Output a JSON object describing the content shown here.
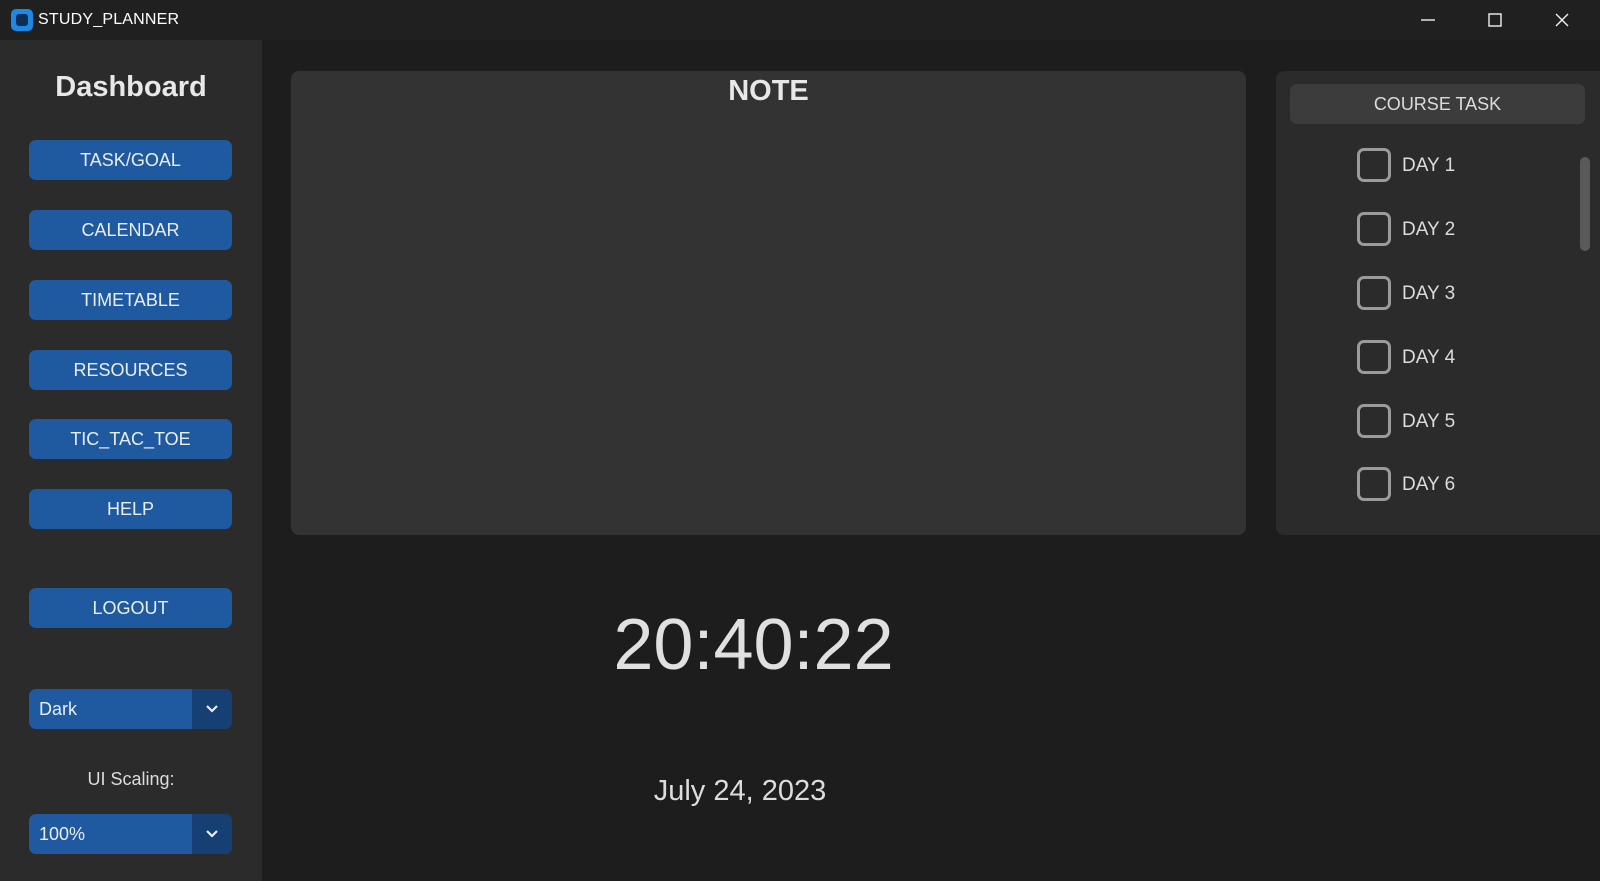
{
  "window": {
    "title": "STUDY_PLANNER"
  },
  "sidebar": {
    "title": "Dashboard",
    "nav": [
      {
        "label": "TASK/GOAL"
      },
      {
        "label": "CALENDAR"
      },
      {
        "label": "TIMETABLE"
      },
      {
        "label": "RESOURCES"
      },
      {
        "label": "TIC_TAC_TOE"
      },
      {
        "label": "HELP"
      }
    ],
    "logout_label": "LOGOUT",
    "appearance_mode": {
      "value": "Dark"
    },
    "scaling_label": "UI Scaling:",
    "scaling": {
      "value": "100%"
    }
  },
  "note": {
    "title": "NOTE"
  },
  "course_task": {
    "header": "COURSE TASK",
    "days": [
      {
        "label": "DAY 1",
        "checked": false
      },
      {
        "label": "DAY 2",
        "checked": false
      },
      {
        "label": "DAY 3",
        "checked": false
      },
      {
        "label": "DAY 4",
        "checked": false
      },
      {
        "label": "DAY 5",
        "checked": false
      },
      {
        "label": "DAY 6",
        "checked": false
      }
    ]
  },
  "clock": {
    "time": "20:40:22",
    "date": "July 24, 2023"
  },
  "colors": {
    "button_blue": "#1f5aa0",
    "background": "#1d1d1d",
    "panel": "#333333"
  }
}
